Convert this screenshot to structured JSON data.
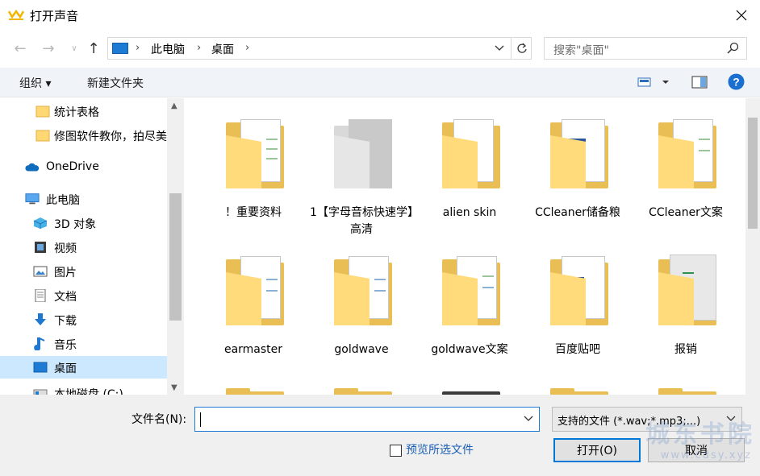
{
  "window": {
    "title": "打开声音"
  },
  "address": {
    "crumbs": [
      "此电脑",
      "桌面"
    ],
    "search_placeholder": "搜索\"桌面\""
  },
  "toolbar": {
    "organize": "组织 ▾",
    "new_folder": "新建文件夹"
  },
  "sidebar": {
    "items": [
      {
        "label": "统计表格",
        "icon": "folder-icon"
      },
      {
        "label": "修图软件教你，拍尽美",
        "icon": "folder-icon"
      },
      {
        "label": "OneDrive",
        "icon": "cloud-icon"
      },
      {
        "label": "此电脑",
        "icon": "computer-icon"
      },
      {
        "label": "3D 对象",
        "icon": "cube-icon"
      },
      {
        "label": "视频",
        "icon": "film-icon"
      },
      {
        "label": "图片",
        "icon": "picture-icon"
      },
      {
        "label": "文档",
        "icon": "document-icon"
      },
      {
        "label": "下载",
        "icon": "download-icon"
      },
      {
        "label": "音乐",
        "icon": "music-icon"
      },
      {
        "label": "桌面",
        "icon": "desktop-icon",
        "selected": true
      },
      {
        "label": "本地磁盘 (C:)",
        "icon": "drive-icon"
      }
    ]
  },
  "files": [
    {
      "name": "！重要资料"
    },
    {
      "name": "1【字母音标快速学】高清"
    },
    {
      "name": "alien skin"
    },
    {
      "name": "CCleaner储备粮"
    },
    {
      "name": "CCleaner文案"
    },
    {
      "name": "earmaster"
    },
    {
      "name": "goldwave"
    },
    {
      "name": "goldwave文案"
    },
    {
      "name": "百度贴吧"
    },
    {
      "name": "报销"
    }
  ],
  "bottom": {
    "filename_label": "文件名(N):",
    "filename_value": "",
    "filter": "支持的文件 (*.wav;*.mp3;...)",
    "preview_label": "预览所选文件",
    "open_button": "打开(O)",
    "cancel_button": "取消",
    "watermark": "城东书院",
    "watermark_url": "www.cdsy.xyz"
  },
  "colors": {
    "accent": "#0078d7",
    "folder": "#ffd874",
    "selection": "#cce8ff"
  }
}
